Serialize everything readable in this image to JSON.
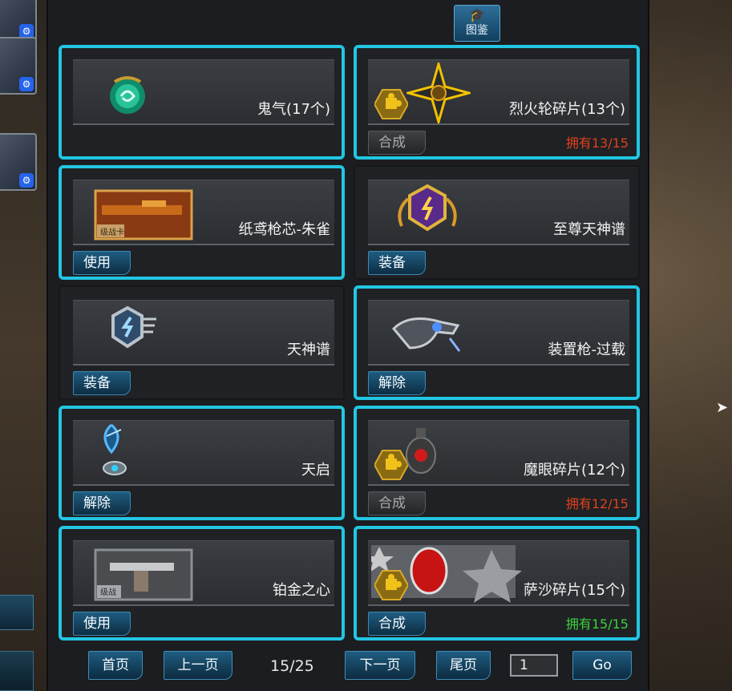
{
  "header": {
    "collection_label": "图鉴",
    "collection_icon": "graduation-cap-icon"
  },
  "items": [
    {
      "name": "鬼气(17个)",
      "action": "",
      "owned": "",
      "selected": true,
      "icon": "green-spirit-orb-icon"
    },
    {
      "name": "烈火轮碎片(13个)",
      "action": "合成",
      "action_disabled": true,
      "owned": "拥有13/15",
      "owned_color": "#e0401d",
      "selected": true,
      "icon": "fire-wheel-shuriken-icon",
      "fragment_icon": "puzzle-piece-icon"
    },
    {
      "name": "纸鸢枪芯-朱雀",
      "action": "使用",
      "owned": "",
      "selected": true,
      "icon": "weapon-card-icon",
      "card_text": "级战卡"
    },
    {
      "name": "至尊天神谱",
      "action": "装备",
      "owned": "",
      "selected": false,
      "icon": "gold-winged-emblem-icon"
    },
    {
      "name": "天神谱",
      "action": "装备",
      "owned": "",
      "selected": false,
      "icon": "silver-winged-emblem-icon"
    },
    {
      "name": "装置枪-过载",
      "action": "解除",
      "owned": "",
      "selected": true,
      "icon": "device-gun-icon"
    },
    {
      "name": "天启",
      "action": "解除",
      "owned": "",
      "selected": true,
      "icon": "apocalypse-device-icon"
    },
    {
      "name": "魔眼碎片(12个)",
      "action": "合成",
      "action_disabled": true,
      "owned": "拥有12/15",
      "owned_color": "#e0401d",
      "selected": true,
      "icon": "demon-eye-grenade-icon",
      "fragment_icon": "puzzle-piece-icon"
    },
    {
      "name": "铂金之心",
      "action": "使用",
      "owned": "",
      "selected": true,
      "icon": "revolver-card-icon",
      "card_text": "级战"
    },
    {
      "name": "萨沙碎片(15个)",
      "action": "合成",
      "action_disabled": false,
      "owned": "拥有15/15",
      "owned_color": "#3bd13b",
      "selected": true,
      "icon": "sasha-character-banner-icon",
      "fragment_icon": "puzzle-piece-icon"
    }
  ],
  "pager": {
    "first": "首页",
    "prev": "上一页",
    "page_indicator": "15/25",
    "next": "下一页",
    "last": "尾页",
    "page_input": "1",
    "go": "Go"
  },
  "colors": {
    "selected_border": "#22c6e3",
    "panel_bg": "#1b1d20",
    "button_blue": "#1f5c80"
  }
}
